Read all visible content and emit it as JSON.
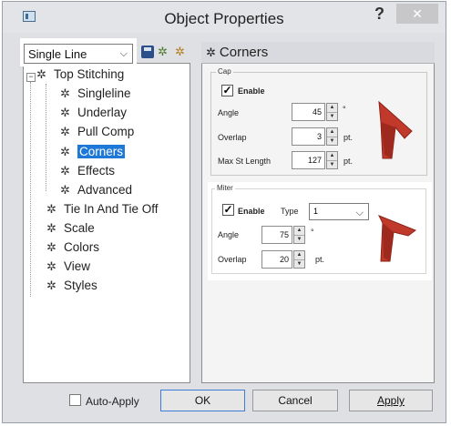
{
  "window": {
    "title": "Object Properties",
    "help_label": "?",
    "close_label": "✕"
  },
  "toolbar": {
    "object_type_value": "Single Line",
    "icons": [
      "save-icon",
      "gear-green-icon",
      "gear-orange-icon"
    ]
  },
  "tree": {
    "root": {
      "label": "Top Stitching",
      "expander": "−"
    },
    "children": [
      {
        "label": "Singleline"
      },
      {
        "label": "Underlay"
      },
      {
        "label": "Pull Comp"
      },
      {
        "label": "Corners",
        "selected": true
      },
      {
        "label": "Effects"
      },
      {
        "label": "Advanced"
      }
    ],
    "top_level": [
      {
        "label": "Tie In And Tie Off"
      },
      {
        "label": "Scale"
      },
      {
        "label": "Colors"
      },
      {
        "label": "View"
      },
      {
        "label": "Styles"
      }
    ]
  },
  "panel": {
    "title": "Corners",
    "cap": {
      "group_label": "Cap",
      "enable_label": "Enable",
      "enable_checked": true,
      "angle_label": "Angle",
      "angle_value": "45",
      "angle_unit": "°",
      "overlap_label": "Overlap",
      "overlap_value": "3",
      "overlap_unit": "pt.",
      "max_st_label": "Max St Length",
      "max_st_value": "127",
      "max_st_unit": "pt."
    },
    "miter": {
      "group_label": "Miter",
      "enable_label": "Enable",
      "enable_checked": true,
      "type_label": "Type",
      "type_value": "1",
      "angle_label": "Angle",
      "angle_value": "75",
      "angle_unit": "°",
      "overlap_label": "Overlap",
      "overlap_value": "20",
      "overlap_unit": "pt."
    }
  },
  "footer": {
    "auto_apply_label": "Auto-Apply",
    "auto_apply_checked": false,
    "ok_label": "OK",
    "cancel_label": "Cancel",
    "apply_label": "Apply"
  },
  "colors": {
    "selection": "#1e78d8",
    "preview": "#c0392b"
  }
}
